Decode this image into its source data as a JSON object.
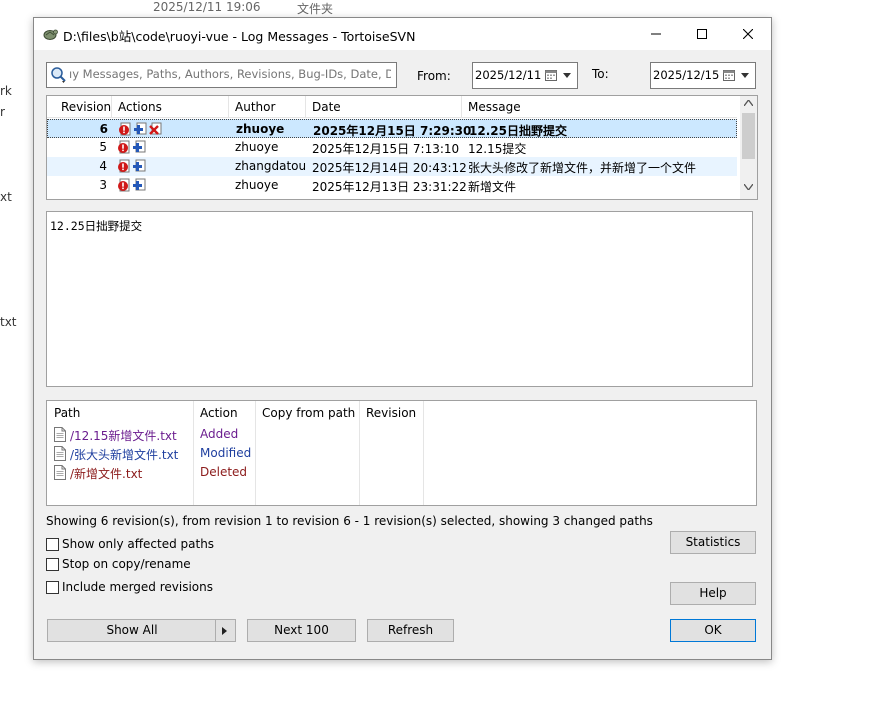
{
  "background": {
    "top_items": [
      "2025/12/11 19:06",
      "文件夹"
    ],
    "left_fragments": [
      "rk",
      "r",
      "xt",
      "txt"
    ]
  },
  "window": {
    "title": "D:\\files\\b站\\code\\ruoyi-vue - Log Messages - TortoiseSVN"
  },
  "filter": {
    "search_placeholder": "ıy Messages, Paths, Authors, Revisions, Bug-IDs, Date, Dat",
    "from_label": "From:",
    "from_value": "2025/12/11",
    "to_label": "To:",
    "to_value": "2025/12/15"
  },
  "log_list": {
    "columns": [
      "Revision",
      "Actions",
      "Author",
      "Date",
      "Message"
    ],
    "rows": [
      {
        "revision": "6",
        "actions": [
          "modified",
          "added",
          "deleted"
        ],
        "author": "zhuoye",
        "date": "2025年12月15日 7:29:30",
        "message": "12.25日拙野提交",
        "selected": true,
        "bold": true
      },
      {
        "revision": "5",
        "actions": [
          "modified",
          "added"
        ],
        "author": "zhuoye",
        "date": "2025年12月15日 7:13:10",
        "message": "12.15提交",
        "selected": false,
        "bold": false
      },
      {
        "revision": "4",
        "actions": [
          "modified",
          "added"
        ],
        "author": "zhangdatou",
        "date": "2025年12月14日 20:43:12",
        "message": "张大头修改了新增文件，并新增了一个文件",
        "selected": false,
        "bold": false
      },
      {
        "revision": "3",
        "actions": [
          "modified",
          "added"
        ],
        "author": "zhuoye",
        "date": "2025年12月13日 23:31:22",
        "message": "新增文件",
        "selected": false,
        "bold": false
      }
    ]
  },
  "message_text": "12.25日拙野提交",
  "changed_paths": {
    "columns": [
      "Path",
      "Action",
      "Copy from path",
      "Revision"
    ],
    "rows": [
      {
        "path": "/12.15新增文件.txt",
        "action": "Added",
        "color": "#6b1d8f"
      },
      {
        "path": "/张大头新增文件.txt",
        "action": "Modified",
        "color": "#1f3f9f"
      },
      {
        "path": "/新增文件.txt",
        "action": "Deleted",
        "color": "#8b1a1a"
      }
    ]
  },
  "status_text": "Showing 6 revision(s), from revision 1 to revision 6 - 1 revision(s) selected, showing 3 changed paths",
  "options": {
    "show_affected": "Show only affected paths",
    "stop_on_copy": "Stop on copy/rename",
    "include_merged": "Include merged revisions"
  },
  "buttons": {
    "statistics": "Statistics",
    "help": "Help",
    "show_all": "Show All",
    "next_100": "Next 100",
    "refresh": "Refresh",
    "ok": "OK"
  },
  "colors": {
    "selection": "#cce8ff",
    "alt_row": "#e8f4ff",
    "accent": "#0078d7"
  }
}
